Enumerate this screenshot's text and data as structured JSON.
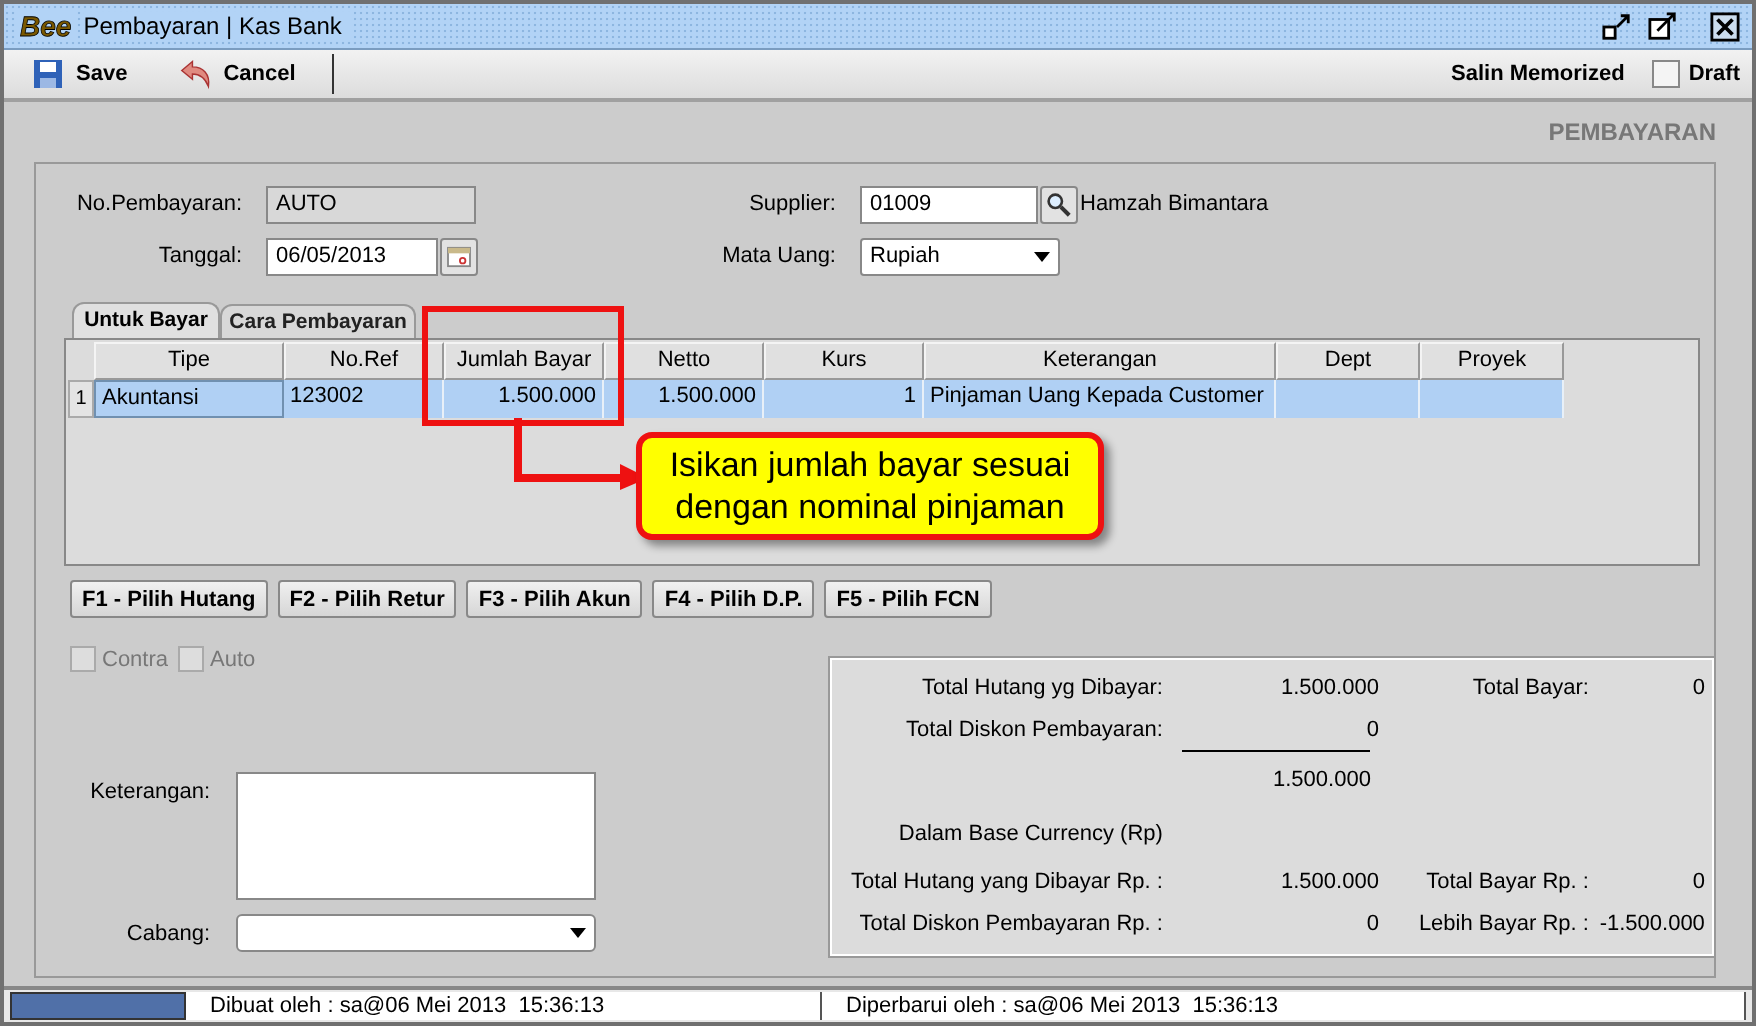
{
  "window": {
    "logo": "Bee",
    "title": "Pembayaran | Kas Bank"
  },
  "toolbar": {
    "buttons": [
      {
        "kind": "save",
        "label": "Save"
      },
      {
        "kind": "cancel",
        "label": "Cancel"
      }
    ],
    "memorized": "Salin Memorized",
    "draft": {
      "label": "Draft",
      "checked": false
    }
  },
  "heading": "PEMBAYARAN",
  "form": {
    "no_pembayaran": {
      "label": "No.Pembayaran:",
      "value": "AUTO"
    },
    "tanggal": {
      "label": "Tanggal:",
      "value": "06/05/2013"
    },
    "supplier": {
      "label": "Supplier:",
      "value": "01009",
      "name": "Hamzah Bimantara"
    },
    "mata_uang": {
      "label": "Mata Uang:",
      "value": "Rupiah"
    }
  },
  "tabs": [
    {
      "label": "Untuk Bayar",
      "selected": true
    },
    {
      "label": "Cara Pembayaran",
      "selected": false
    }
  ],
  "table": {
    "columns": [
      {
        "label": "Tipe",
        "kind": "text"
      },
      {
        "label": "No.Ref",
        "kind": "text"
      },
      {
        "label": "Jumlah Bayar",
        "kind": "number"
      },
      {
        "label": "Netto",
        "kind": "number"
      },
      {
        "label": "Kurs",
        "kind": "number"
      },
      {
        "label": "Keterangan",
        "kind": "text"
      },
      {
        "label": "Dept",
        "kind": "text"
      },
      {
        "label": "Proyek",
        "kind": "text"
      }
    ],
    "rows": [
      {
        "number": "1",
        "selected": true,
        "cells": [
          "Akuntansi",
          "123002",
          "1.500.000",
          "1.500.000",
          "1",
          "Pinjaman Uang Kepada Customer"
        ]
      }
    ]
  },
  "function_buttons": [
    "F1 - Pilih Hutang",
    "F2 - Pilih Retur",
    "F3 - Pilih Akun",
    "F4 - Pilih D.P.",
    "F5 - Pilih FCN"
  ],
  "options": [
    {
      "label": "Contra",
      "checked": false,
      "disabled": true
    },
    {
      "label": "Auto",
      "checked": false,
      "disabled": true
    }
  ],
  "keterangan": {
    "label": "Keterangan:"
  },
  "cabang": {
    "label": "Cabang:"
  },
  "summary": [
    {
      "kind": "row",
      "label": "Total Hutang yg Dibayar:",
      "value": "1.500.000",
      "label_2": "Total Bayar:",
      "value_2": "0"
    },
    {
      "kind": "row",
      "label": "Total Diskon Pembayaran:",
      "value": "0"
    },
    {
      "kind": "subtotal",
      "value": "1.500.000"
    },
    {
      "kind": "heading",
      "label": "Dalam Base Currency (Rp)"
    },
    {
      "kind": "row",
      "label": "Total Hutang yang Dibayar Rp. :",
      "value": "1.500.000",
      "label_2": "Total Bayar Rp. :",
      "value_2": "0"
    },
    {
      "kind": "row",
      "label": "Total Diskon Pembayaran Rp. :",
      "value": "0",
      "label_2": "Lebih Bayar Rp. :",
      "value_2": "-1.500.000"
    }
  ],
  "status_bar": [
    "Dibuat oleh : sa@06 Mei 2013  15:36:13",
    "Diperbarui oleh : sa@06 Mei 2013  15:36:13"
  ],
  "annotation": {
    "lines": [
      "Isikan jumlah bayar sesuai",
      "dengan nominal pinjaman"
    ]
  }
}
